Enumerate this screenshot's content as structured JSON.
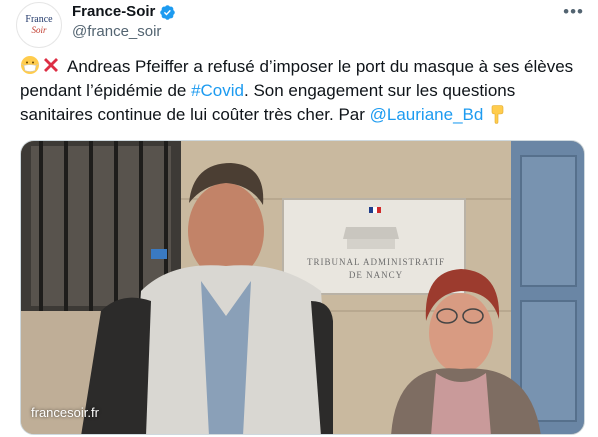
{
  "account": {
    "avatar_line1": "France",
    "avatar_line2": "Soir",
    "display_name": "France-Soir",
    "handle": "@france_soir",
    "verified_color": "#1d9bf0"
  },
  "menu_icon": "more-dots-icon",
  "tweet": {
    "text_part1": "Andreas Pfeiffer a refusé d’imposer le port du masque à ses élèves pendant l’épidémie de ",
    "hashtag": "#Covid",
    "text_part2": ". Son engagement sur les questions sanitaires continue de lui coûter très cher. Par ",
    "mention": "@Lauriane_Bd",
    "emojis": [
      "mask-face-emoji",
      "cross-mark-emoji",
      "pointing-down-emoji"
    ]
  },
  "media": {
    "plaque_line1": "TRIBUNAL ADMINISTRATIF",
    "plaque_line2": "DE NANCY",
    "watermark": "francesoir.fr"
  }
}
